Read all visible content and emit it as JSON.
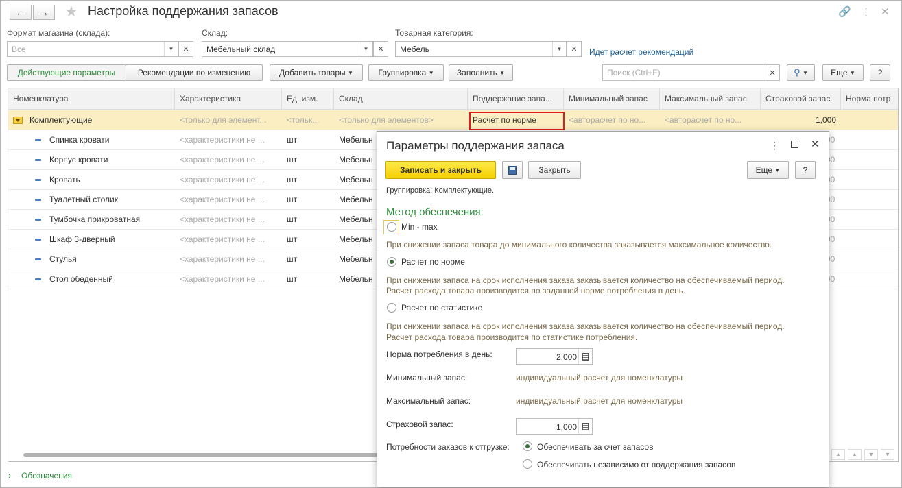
{
  "window": {
    "title": "Настройка поддержания запасов"
  },
  "filters": {
    "format_label": "Формат магазина (склада):",
    "format_placeholder": "Все",
    "warehouse_label": "Склад:",
    "warehouse_value": "Мебельный склад",
    "category_label": "Товарная категория:",
    "category_value": "Мебель",
    "calc_link": "Идет расчет рекомендаций"
  },
  "toolbar": {
    "tab_active": "Действующие параметры",
    "tab_recommendations": "Рекомендации по изменению",
    "add_goods": "Добавить товары",
    "grouping": "Группировка",
    "fill": "Заполнить",
    "search_placeholder": "Поиск (Ctrl+F)",
    "more": "Еще",
    "help": "?"
  },
  "table": {
    "columns": [
      "Номенклатура",
      "Характеристика",
      "Ед. изм.",
      "Склад",
      "Поддержание запа...",
      "Минимальный запас",
      "Максимальный запас",
      "Страховой запас",
      "Норма потр"
    ],
    "group_row": {
      "name": "Комплектующие",
      "characteristic": "<только для элемент...",
      "unit": "<тольк...",
      "warehouse": "<только для элементов>",
      "support": "Расчет по норме",
      "min": "<авторасчет по но...",
      "max": "<авторасчет по но...",
      "safety": "1,000"
    },
    "rows": [
      {
        "name": "Спинка кровати",
        "characteristic": "<характеристики не ...",
        "unit": "шт",
        "warehouse": "Мебельн",
        "extra": "00"
      },
      {
        "name": "Корпус кровати",
        "characteristic": "<характеристики не ...",
        "unit": "шт",
        "warehouse": "Мебельн",
        "extra": "00"
      },
      {
        "name": "Кровать",
        "characteristic": "<характеристики не ...",
        "unit": "шт",
        "warehouse": "Мебельн",
        "extra": "00"
      },
      {
        "name": "Туалетный столик",
        "characteristic": "<характеристики не ...",
        "unit": "шт",
        "warehouse": "Мебельн",
        "extra": "00"
      },
      {
        "name": "Тумбочка прикроватная",
        "characteristic": "<характеристики не ...",
        "unit": "шт",
        "warehouse": "Мебельн",
        "extra": "00"
      },
      {
        "name": "Шкаф 3-дверный",
        "characteristic": "<характеристики не ...",
        "unit": "шт",
        "warehouse": "Мебельн",
        "extra": "00"
      },
      {
        "name": "Стулья",
        "characteristic": "<характеристики не ...",
        "unit": "шт",
        "warehouse": "Мебельн",
        "extra": "00"
      },
      {
        "name": "Стол обеденный",
        "characteristic": "<характеристики не ...",
        "unit": "шт",
        "warehouse": "Мебельн",
        "extra": "00"
      }
    ]
  },
  "footer": {
    "legend_link": "Обозначения"
  },
  "dialog": {
    "title": "Параметры поддержания запаса",
    "save_close": "Записать и закрыть",
    "close": "Закрыть",
    "more": "Еще",
    "help": "?",
    "grouping_info": "Группировка: Комплектующие.",
    "method_header": "Метод обеспечения:",
    "opt_minmax": "Min - max",
    "opt_minmax_hint": "При снижении запаса товара до минимального количества заказывается максимальное количество.",
    "opt_norm": "Расчет по норме",
    "opt_norm_hint1": "При снижении запаса на срок исполнения заказа заказывается количество на обеспечиваемый период.",
    "opt_norm_hint2": "Расчет расхода товара производится по заданной норме потребления в день.",
    "opt_stat": "Расчет по статистике",
    "opt_stat_hint1": "При снижении запаса на срок исполнения заказа заказывается количество на обеспечиваемый период.",
    "opt_stat_hint2": "Расчет расхода товара производится по статистике потребления.",
    "norm_label": "Норма потребления в день:",
    "norm_value": "2,000",
    "min_label": "Минимальный запас:",
    "min_value": "индивидуальный расчет для номенклатуры",
    "max_label": "Максимальный запас:",
    "max_value": "индивидуальный расчет для номенклатуры",
    "safety_label": "Страховой запас:",
    "safety_value": "1,000",
    "orders_label": "Потребности заказов к отгрузке:",
    "orders_opt1": "Обеспечивать за счет запасов",
    "orders_opt2": "Обеспечивать независимо от поддержания запасов"
  },
  "colors": {
    "accent_green": "#2a8b3c",
    "selected_row": "#fbeec3",
    "primary_button": "#f5d800",
    "highlight_border": "#e21b1b"
  }
}
